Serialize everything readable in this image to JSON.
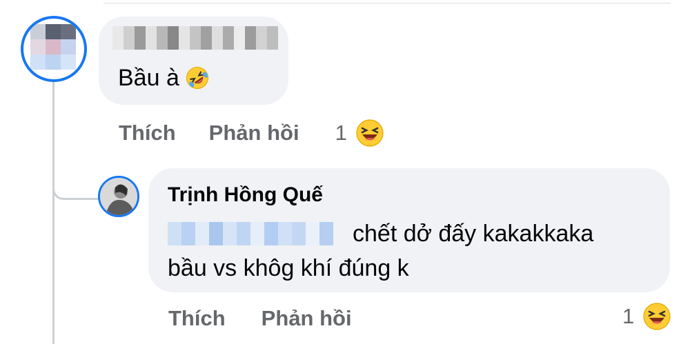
{
  "comment": {
    "text": "Bầu à",
    "text_emoji": "rolling-on-floor-laughing-icon",
    "actions": {
      "like": "Thích",
      "reply": "Phản hồi"
    },
    "reaction": {
      "count": "1",
      "icon": "haha-reaction-icon"
    }
  },
  "reply": {
    "author": "Trịnh Hồng Quế",
    "line1": "chết dở đấy kakakkaka",
    "line2": "bầu vs khôg khí đúng k",
    "actions": {
      "like": "Thích",
      "reply": "Phản hồi"
    },
    "reaction": {
      "count": "1",
      "icon": "haha-reaction-icon"
    }
  },
  "colors": {
    "accent": "#1877f2",
    "bubble": "#f0f2f5",
    "muted_text": "#65676b",
    "emoji_yellow": "#ffcc33"
  }
}
